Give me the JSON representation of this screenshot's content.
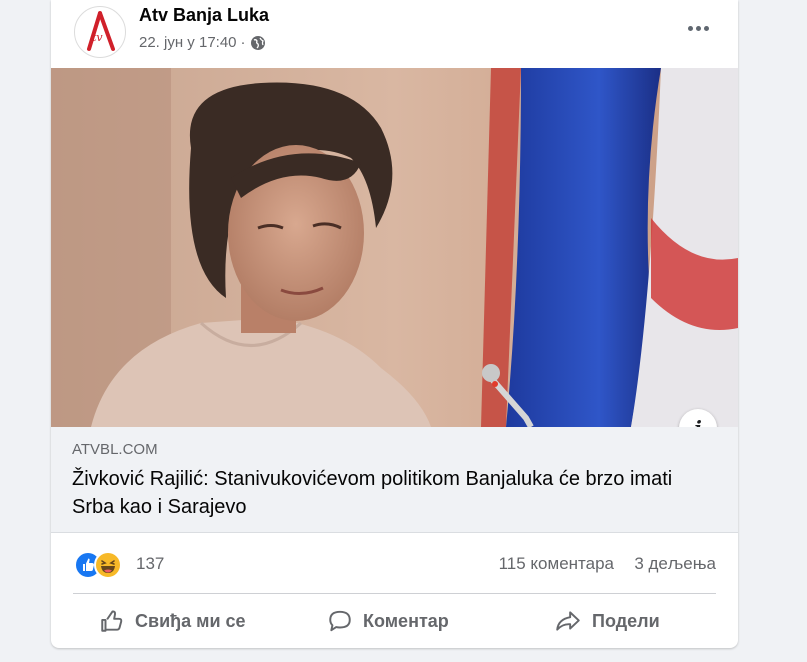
{
  "post": {
    "page_name": "Atv Banja Luka",
    "logo_text": "tv",
    "timestamp": "22. јун у 17:40",
    "separator": "·",
    "audience_icon": "globe-icon",
    "more_icon": "more-options-icon"
  },
  "link": {
    "domain": "ATVBL.COM",
    "headline": "Živković Rajilić: Stanivukovićevom politikom Banjaluka će brzo imati Srba kao i Sarajevo",
    "info_icon": "info-icon",
    "info_label": "i"
  },
  "stats": {
    "reactions": [
      "like",
      "haha"
    ],
    "reaction_count": "137",
    "comments": "115 коментара",
    "shares": "3 дељења"
  },
  "actions": {
    "like": "Свиђа ми се",
    "comment": "Коментар",
    "share": "Подели"
  },
  "colors": {
    "accent": "#1877f2",
    "haha": "#f7b928",
    "muted_text": "#65676b",
    "link_box_bg": "#f0f2f5"
  }
}
